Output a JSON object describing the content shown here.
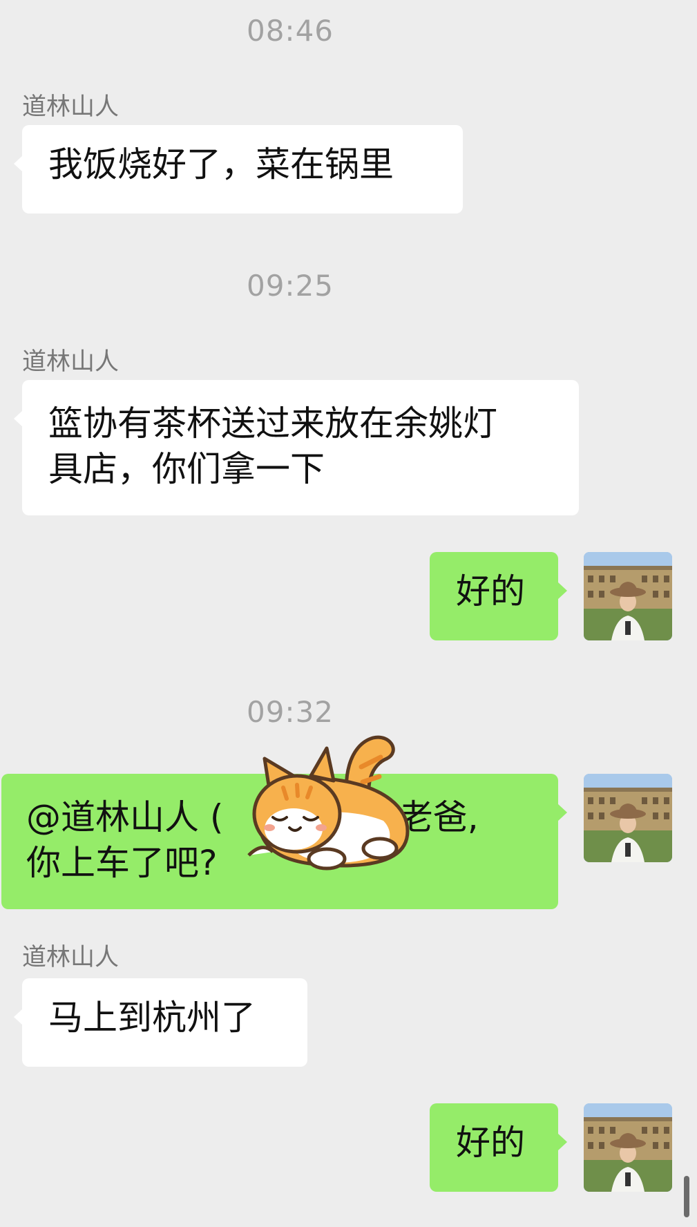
{
  "timestamps": [
    "08:46",
    "09:25",
    "09:32"
  ],
  "messages": [
    {
      "sender": "道林山人",
      "text": "我饭烧好了，菜在锅里"
    },
    {
      "sender": "道林山人",
      "line1": "篮协有茶杯送过来放在余姚灯",
      "line2": "具店，你们拿一下"
    },
    {
      "text": "好的"
    },
    {
      "line1": "@道林山人 (",
      "line1_tail": ") 老爸,",
      "line2": "你上车了吧?"
    },
    {
      "sender": "道林山人",
      "text": "马上到杭州了"
    },
    {
      "text": "好的"
    }
  ],
  "icons": {
    "avatar": "avatar-photo",
    "sticker": "sleeping-cat-sticker"
  },
  "colors": {
    "background": "#ededed",
    "incoming_bubble": "#ffffff",
    "outgoing_bubble": "#95ec69"
  }
}
